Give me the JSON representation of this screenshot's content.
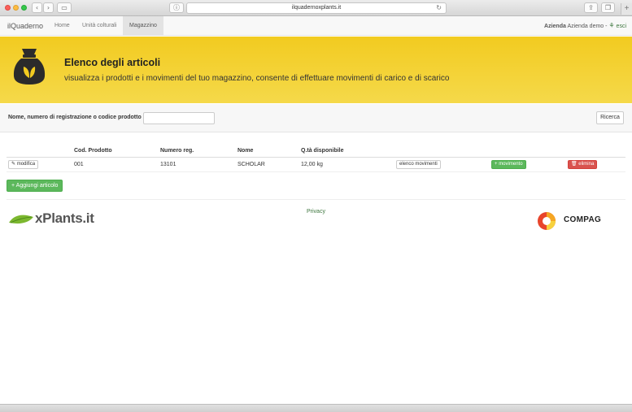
{
  "browser": {
    "url": "ilquadernoxplants.it",
    "back_icon": "chevron-left-icon",
    "forward_icon": "chevron-right-icon"
  },
  "navbar": {
    "brand": "ilQuaderno",
    "items": [
      {
        "label": "Home"
      },
      {
        "label": "Unità colturali"
      },
      {
        "label": "Magazzino",
        "active": true
      }
    ],
    "company_label": "Azienda",
    "company_name": "Azienda demo -",
    "logout": "esci"
  },
  "header": {
    "icon": "sack-icon",
    "title": "Elenco degli articoli",
    "subtitle": "visualizza i prodotti e i movimenti del tuo magazzino, consente di effettuare movimenti di carico e di scarico"
  },
  "search": {
    "label": "Nome, numero di registrazione o codice prodotto",
    "value": "",
    "button": "Ricerca"
  },
  "table": {
    "columns": [
      "Cod. Prodotto",
      "Numero reg.",
      "Nome",
      "Q.tà disponibile"
    ],
    "rows": [
      {
        "edit": "modifica",
        "code": "001",
        "reg": "13101",
        "name": "SCHOLAR",
        "qty": "12,00 kg",
        "movements": "elenco movimenti",
        "add_movement": "movimento",
        "delete": "elimina"
      }
    ]
  },
  "add_button": "Aggiungi articolo",
  "footer": {
    "privacy": "Privacy",
    "logo_left": "xPlants.it",
    "logo_right": "COMPAG"
  },
  "colors": {
    "jumbotron": "#f2cb20",
    "success": "#5cb85c",
    "danger": "#d9534f",
    "link": "#3c763d"
  }
}
